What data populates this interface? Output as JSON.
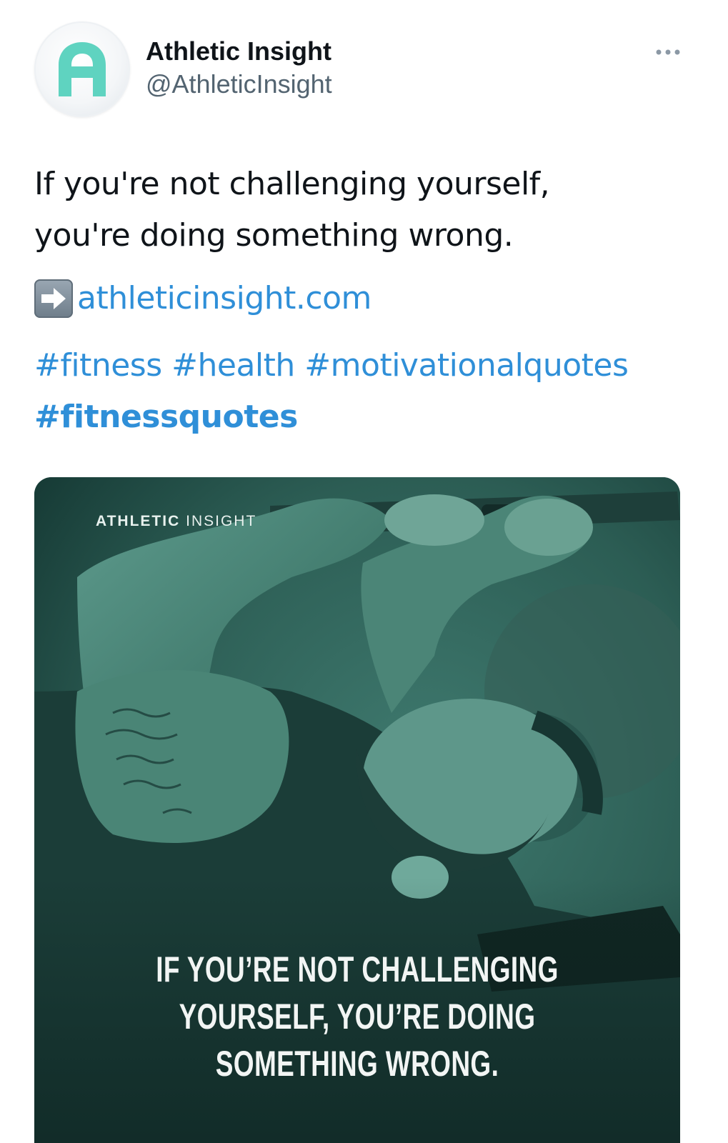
{
  "tweet": {
    "display_name": "Athletic Insight",
    "handle": "@AthleticInsight",
    "avatar_icon": "athletic-insight-logo",
    "more_icon": "more-dots-icon",
    "text_line1": "If you're not challenging yourself,",
    "text_line2": "you're doing something wrong.",
    "link_emoji": "right-arrow-emoji",
    "link_text": "athleticinsight.com",
    "hashtags": [
      "#fitness",
      "#health",
      "#motivationalquotes",
      "#fitnessquotes"
    ],
    "accent_color": "#2f8fd8"
  },
  "media": {
    "brand_prefix": "ATHLETIC",
    "brand_suffix": "INSIGHT",
    "quote_line1": "IF YOU’RE NOT CHALLENGING",
    "quote_line2": "YOURSELF, YOU’RE DOING",
    "quote_line3": "SOMETHING WRONG.",
    "tint_color": "#2b5a52"
  }
}
